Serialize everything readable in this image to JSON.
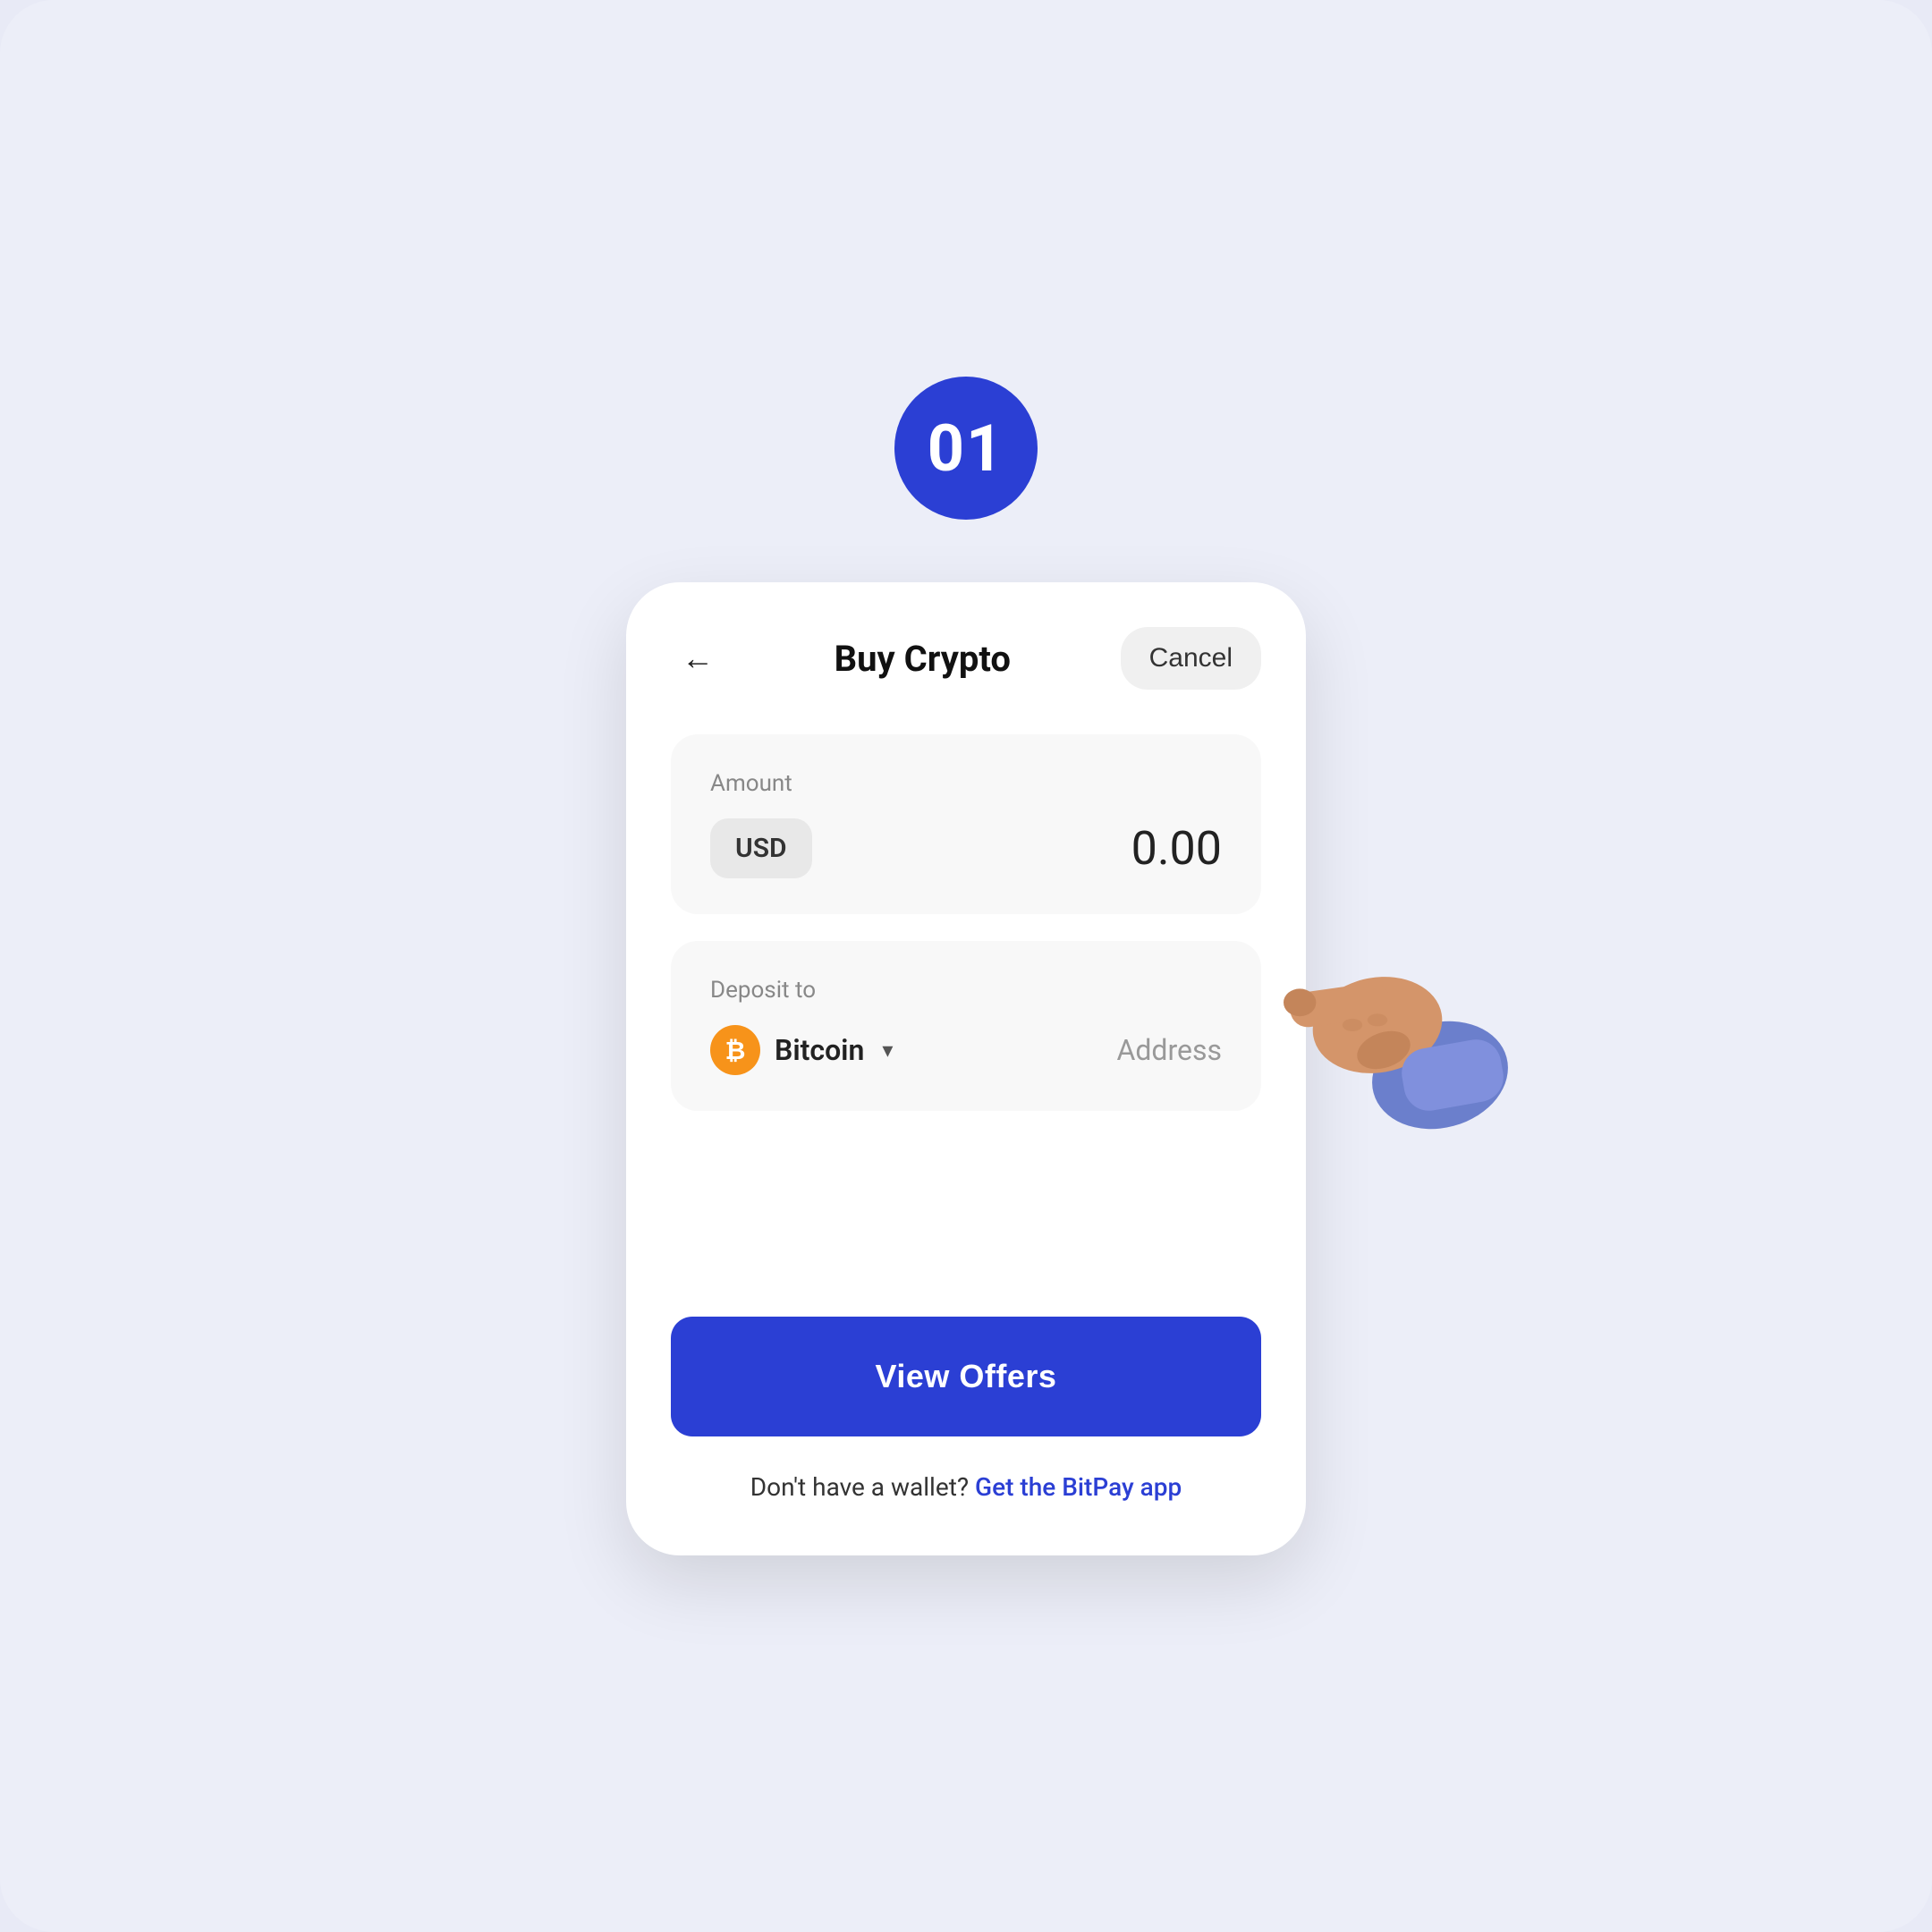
{
  "step": {
    "number": "01"
  },
  "header": {
    "title": "Buy Crypto",
    "cancel_label": "Cancel",
    "back_label": "←"
  },
  "amount_section": {
    "label": "Amount",
    "currency": "USD",
    "value": "0.00"
  },
  "deposit_section": {
    "label": "Deposit to",
    "crypto_name": "Bitcoin",
    "address_placeholder": "Address"
  },
  "cta": {
    "view_offers_label": "View Offers"
  },
  "footer": {
    "text": "Don't have a wallet?",
    "link_text": "Get the BitPay app"
  }
}
